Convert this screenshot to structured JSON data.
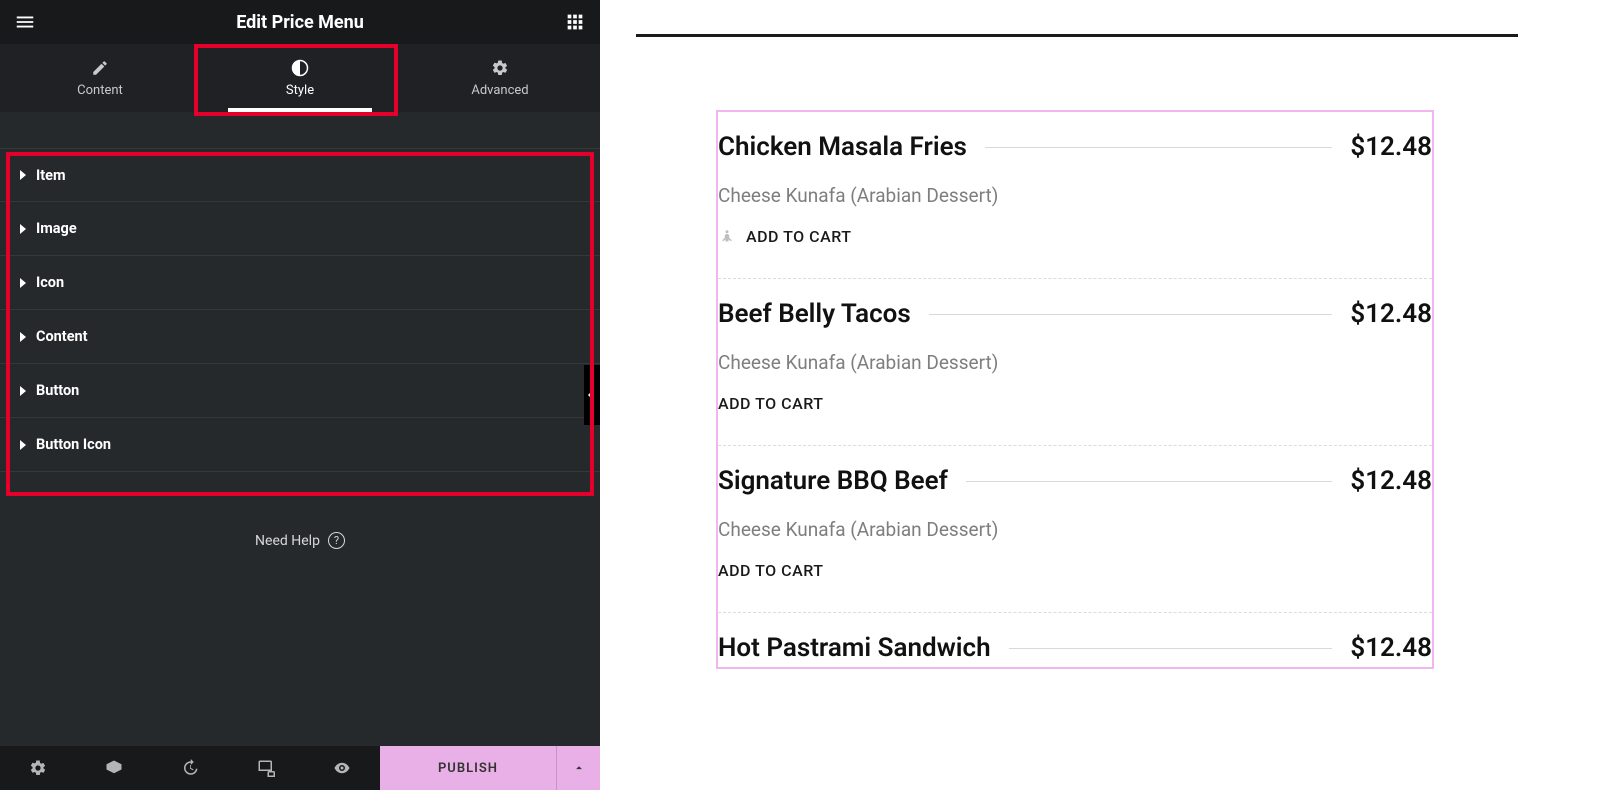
{
  "panel": {
    "title": "Edit Price Menu",
    "tabs": [
      {
        "label": "Content",
        "active": false
      },
      {
        "label": "Style",
        "active": true
      },
      {
        "label": "Advanced",
        "active": false
      }
    ],
    "sections": [
      {
        "label": "Item"
      },
      {
        "label": "Image"
      },
      {
        "label": "Icon"
      },
      {
        "label": "Content"
      },
      {
        "label": "Button"
      },
      {
        "label": "Button Icon"
      }
    ],
    "need_help": "Need Help",
    "publish": "PUBLISH"
  },
  "menu_items": [
    {
      "title": "Chicken Masala Fries",
      "price": "$12.48",
      "desc": "Cheese Kunafa (Arabian Dessert)",
      "cta": "ADD TO CART",
      "show_icon": true
    },
    {
      "title": "Beef Belly Tacos",
      "price": "$12.48",
      "desc": "Cheese Kunafa (Arabian Dessert)",
      "cta": "ADD TO CART",
      "show_icon": false
    },
    {
      "title": "Signature BBQ Beef",
      "price": "$12.48",
      "desc": "Cheese Kunafa (Arabian Dessert)",
      "cta": "ADD TO CART",
      "show_icon": false
    },
    {
      "title": "Hot Pastrami Sandwich",
      "price": "$12.48",
      "desc": "",
      "cta": "",
      "show_icon": false
    }
  ],
  "colors": {
    "highlight": "#e4002b",
    "widget_outline": "#f2b6ef",
    "publish_bg": "#e8b0e6"
  }
}
